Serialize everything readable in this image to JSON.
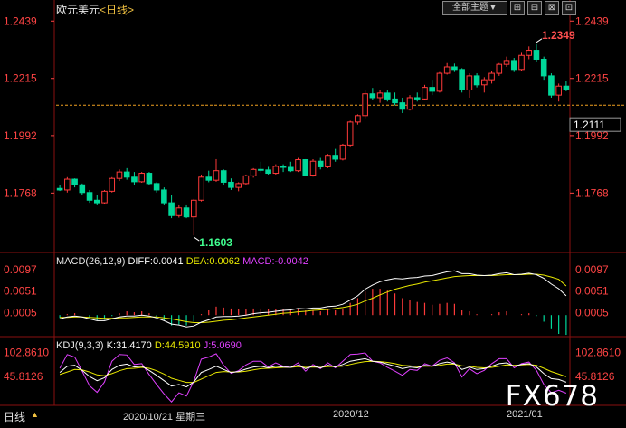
{
  "header": {
    "symbol": "欧元美元",
    "timeframe": "<日线>",
    "toolbar": {
      "theme_label": "全部主题",
      "theme_arrow": "▼",
      "buttons": [
        "⊞",
        "⊟",
        "⊠",
        "⊡"
      ]
    }
  },
  "colors": {
    "up": "#ff3a3a",
    "down": "#00d89a",
    "ma": "#ffffff",
    "dea": "#e8e800",
    "k": "#ffffff",
    "d": "#e8e800",
    "j": "#e040ff",
    "axis": "#ff4444",
    "grid": "#8a1010"
  },
  "chart_data": [
    {
      "type": "candlestick",
      "title": "欧元美元<日线>",
      "y_ticks": [
        "1.2439",
        "1.2215",
        "1.1992",
        "1.1768"
      ],
      "ylim": [
        1.1568,
        1.25
      ],
      "last_price": "1.2111",
      "high_annotation": "1.2349",
      "low_annotation": "1.1603",
      "ohlc": [
        [
          1.1786,
          1.1798,
          1.1776,
          1.178
        ],
        [
          1.178,
          1.183,
          1.177,
          1.1822
        ],
        [
          1.1822,
          1.1825,
          1.179,
          1.18
        ],
        [
          1.18,
          1.1805,
          1.176,
          1.177
        ],
        [
          1.177,
          1.178,
          1.173,
          1.174
        ],
        [
          1.174,
          1.176,
          1.172,
          1.173
        ],
        [
          1.173,
          1.178,
          1.1725,
          1.1775
        ],
        [
          1.1775,
          1.183,
          1.177,
          1.1825
        ],
        [
          1.1825,
          1.186,
          1.1815,
          1.185
        ],
        [
          1.185,
          1.1865,
          1.182,
          1.183
        ],
        [
          1.183,
          1.185,
          1.18,
          1.1812
        ],
        [
          1.1812,
          1.185,
          1.1808,
          1.1845
        ],
        [
          1.1845,
          1.185,
          1.18,
          1.1805
        ],
        [
          1.1805,
          1.181,
          1.177,
          1.178
        ],
        [
          1.178,
          1.179,
          1.172,
          1.173
        ],
        [
          1.173,
          1.176,
          1.167,
          1.168
        ],
        [
          1.168,
          1.172,
          1.1672,
          1.171
        ],
        [
          1.171,
          1.172,
          1.167,
          1.1675
        ],
        [
          1.1675,
          1.1745,
          1.1603,
          1.174
        ],
        [
          1.174,
          1.184,
          1.1735,
          1.183
        ],
        [
          1.183,
          1.1855,
          1.181,
          1.1818
        ],
        [
          1.1818,
          1.19,
          1.1812,
          1.1855
        ],
        [
          1.1855,
          1.186,
          1.18,
          1.181
        ],
        [
          1.181,
          1.1825,
          1.178,
          1.179
        ],
        [
          1.179,
          1.181,
          1.1775,
          1.1805
        ],
        [
          1.1805,
          1.184,
          1.18,
          1.1835
        ],
        [
          1.1835,
          1.1865,
          1.1828,
          1.186
        ],
        [
          1.186,
          1.189,
          1.1848,
          1.1858
        ],
        [
          1.1858,
          1.187,
          1.184,
          1.1845
        ],
        [
          1.1845,
          1.188,
          1.184,
          1.1872
        ],
        [
          1.1872,
          1.188,
          1.185,
          1.1868
        ],
        [
          1.1868,
          1.189,
          1.185,
          1.1855
        ],
        [
          1.1855,
          1.1905,
          1.185,
          1.1898
        ],
        [
          1.1898,
          1.19,
          1.1835,
          1.1838
        ],
        [
          1.1838,
          1.19,
          1.1832,
          1.1892
        ],
        [
          1.1892,
          1.1905,
          1.186,
          1.187
        ],
        [
          1.187,
          1.192,
          1.1865,
          1.1915
        ],
        [
          1.1915,
          1.194,
          1.189,
          1.19
        ],
        [
          1.19,
          1.196,
          1.1895,
          1.1955
        ],
        [
          1.1955,
          1.205,
          1.195,
          1.2045
        ],
        [
          1.2045,
          1.2075,
          1.2035,
          1.207
        ],
        [
          1.207,
          1.217,
          1.206,
          1.2155
        ],
        [
          1.2155,
          1.2178,
          1.213,
          1.214
        ],
        [
          1.214,
          1.217,
          1.212,
          1.2158
        ],
        [
          1.2158,
          1.2168,
          1.2125,
          1.2135
        ],
        [
          1.2135,
          1.216,
          1.211,
          1.212
        ],
        [
          1.212,
          1.214,
          1.208,
          1.2095
        ],
        [
          1.2095,
          1.215,
          1.209,
          1.214
        ],
        [
          1.214,
          1.216,
          1.2125,
          1.2135
        ],
        [
          1.2135,
          1.219,
          1.213,
          1.218
        ],
        [
          1.218,
          1.221,
          1.215,
          1.2165
        ],
        [
          1.2165,
          1.224,
          1.216,
          1.2235
        ],
        [
          1.2235,
          1.2275,
          1.223,
          1.226
        ],
        [
          1.226,
          1.2273,
          1.224,
          1.225
        ],
        [
          1.225,
          1.2255,
          1.216,
          1.217
        ],
        [
          1.217,
          1.2235,
          1.214,
          1.2225
        ],
        [
          1.2225,
          1.2235,
          1.218,
          1.219
        ],
        [
          1.219,
          1.222,
          1.216,
          1.221
        ],
        [
          1.221,
          1.2245,
          1.2195,
          1.2235
        ],
        [
          1.2235,
          1.2275,
          1.2225,
          1.227
        ],
        [
          1.227,
          1.23,
          1.226,
          1.2285
        ],
        [
          1.2285,
          1.2295,
          1.224,
          1.225
        ],
        [
          1.225,
          1.2315,
          1.2245,
          1.2305
        ],
        [
          1.2305,
          1.234,
          1.229,
          1.2325
        ],
        [
          1.2325,
          1.2349,
          1.228,
          1.229
        ],
        [
          1.229,
          1.23,
          1.221,
          1.2225
        ],
        [
          1.2225,
          1.2235,
          1.214,
          1.215
        ],
        [
          1.215,
          1.2195,
          1.2125,
          1.2185
        ],
        [
          1.2185,
          1.2205,
          1.2165,
          1.217
        ]
      ]
    },
    {
      "type": "line",
      "title": "MACD(26,12,9)",
      "labels": {
        "name": "MACD(26,12,9)",
        "diff": "DIFF:0.0041",
        "dea": "DEA:0.0062",
        "macd": "MACD:-0.0042"
      },
      "y_ticks": [
        "0.0097",
        "0.0051",
        "0.0005"
      ],
      "ylim": [
        -0.004,
        0.011
      ],
      "diff": [
        -0.0008,
        -0.0004,
        -0.0002,
        -0.0004,
        -0.0008,
        -0.0012,
        -0.0012,
        -0.0008,
        -0.0004,
        -0.0002,
        -0.0002,
        0.0,
        -0.0002,
        -0.0006,
        -0.0012,
        -0.0019,
        -0.0021,
        -0.0025,
        -0.0023,
        -0.0015,
        -0.001,
        -0.0004,
        -0.0003,
        -0.0003,
        -0.0002,
        0.0,
        0.0003,
        0.0005,
        0.0006,
        0.0008,
        0.001,
        0.0011,
        0.0014,
        0.0013,
        0.0015,
        0.0015,
        0.0018,
        0.0019,
        0.0023,
        0.0032,
        0.0041,
        0.0055,
        0.0064,
        0.0071,
        0.0075,
        0.0078,
        0.0077,
        0.0079,
        0.008,
        0.0083,
        0.0084,
        0.0088,
        0.0092,
        0.0094,
        0.0088,
        0.0088,
        0.0085,
        0.0084,
        0.0085,
        0.0088,
        0.009,
        0.0086,
        0.0087,
        0.0089,
        0.0086,
        0.0078,
        0.0066,
        0.0056,
        0.0041
      ],
      "dea": [
        -0.0005,
        -0.0005,
        -0.0004,
        -0.0004,
        -0.0005,
        -0.0006,
        -0.0007,
        -0.0007,
        -0.0006,
        -0.0006,
        -0.0005,
        -0.0004,
        -0.0004,
        -0.0004,
        -0.0006,
        -0.0008,
        -0.0011,
        -0.0014,
        -0.0016,
        -0.0016,
        -0.0015,
        -0.0013,
        -0.0011,
        -0.001,
        -0.0008,
        -0.0006,
        -0.0004,
        -0.0002,
        0.0,
        0.0002,
        0.0004,
        0.0005,
        0.0007,
        0.0008,
        0.001,
        0.0011,
        0.0012,
        0.0014,
        0.0016,
        0.0019,
        0.0023,
        0.003,
        0.0036,
        0.0043,
        0.0049,
        0.0055,
        0.0059,
        0.0063,
        0.0066,
        0.007,
        0.0073,
        0.0076,
        0.0079,
        0.0082,
        0.0083,
        0.0084,
        0.0084,
        0.0084,
        0.0084,
        0.0085,
        0.0086,
        0.0086,
        0.0086,
        0.0087,
        0.0087,
        0.0085,
        0.0081,
        0.0076,
        0.0062
      ],
      "histogram": [
        -0.0006,
        0.0002,
        0.0004,
        0.0,
        -0.0006,
        -0.0012,
        -0.001,
        -0.0002,
        0.0004,
        0.0008,
        0.0006,
        0.0008,
        0.0004,
        -0.0004,
        -0.0012,
        -0.0022,
        -0.002,
        -0.0022,
        -0.0014,
        0.0002,
        0.001,
        0.0018,
        0.0016,
        0.0014,
        0.0012,
        0.0012,
        0.0014,
        0.0014,
        0.0012,
        0.0012,
        0.0012,
        0.0012,
        0.0014,
        0.001,
        0.001,
        0.0008,
        0.0012,
        0.001,
        0.0014,
        0.0026,
        0.0036,
        0.005,
        0.0056,
        0.0056,
        0.0052,
        0.0046,
        0.0036,
        0.0032,
        0.0028,
        0.0026,
        0.0022,
        0.0024,
        0.0026,
        0.0024,
        0.001,
        0.0008,
        0.0002,
        0.0,
        0.0002,
        0.0006,
        0.0008,
        0.0,
        0.0002,
        0.0004,
        -0.0002,
        -0.0014,
        -0.003,
        -0.004,
        -0.0042
      ]
    },
    {
      "type": "line",
      "title": "KDJ(9,3,3)",
      "labels": {
        "name": "KDJ(9,3,3)",
        "k": "K:31.4170",
        "d": "D:44.5910",
        "j": "J:5.0690"
      },
      "y_ticks": [
        "102.8610",
        "45.8126"
      ],
      "ylim": [
        -20,
        115
      ],
      "k": [
        55,
        70,
        72,
        60,
        45,
        35,
        42,
        62,
        72,
        75,
        68,
        70,
        60,
        48,
        35,
        22,
        26,
        20,
        32,
        55,
        62,
        70,
        62,
        55,
        57,
        63,
        68,
        70,
        66,
        70,
        68,
        67,
        72,
        64,
        70,
        66,
        72,
        68,
        74,
        82,
        85,
        88,
        82,
        80,
        75,
        70,
        64,
        68,
        66,
        72,
        70,
        76,
        80,
        76,
        62,
        68,
        62,
        64,
        70,
        76,
        78,
        70,
        74,
        76,
        68,
        52,
        40,
        38,
        31.417
      ],
      "d": [
        50,
        56,
        62,
        61,
        56,
        49,
        47,
        52,
        59,
        64,
        65,
        67,
        65,
        59,
        51,
        41,
        36,
        31,
        31,
        39,
        47,
        55,
        57,
        56,
        56,
        58,
        61,
        64,
        65,
        66,
        67,
        67,
        69,
        67,
        68,
        67,
        69,
        69,
        70,
        74,
        78,
        81,
        82,
        81,
        79,
        76,
        72,
        71,
        69,
        70,
        70,
        72,
        75,
        75,
        71,
        70,
        67,
        66,
        67,
        70,
        73,
        72,
        73,
        74,
        72,
        65,
        57,
        51,
        44.591
      ],
      "j": [
        65,
        98,
        92,
        58,
        23,
        7,
        32,
        82,
        98,
        97,
        74,
        76,
        50,
        26,
        3,
        -16,
        6,
        -2,
        34,
        87,
        92,
        100,
        72,
        53,
        59,
        73,
        82,
        82,
        68,
        78,
        70,
        67,
        78,
        58,
        74,
        64,
        78,
        66,
        82,
        98,
        99,
        102,
        82,
        78,
        67,
        58,
        48,
        62,
        60,
        76,
        70,
        84,
        90,
        78,
        44,
        64,
        52,
        60,
        76,
        88,
        88,
        66,
        76,
        80,
        60,
        26,
        6,
        12,
        5.069
      ]
    }
  ],
  "x_axis_labels": [
    "2020/10/21 星期三",
    "2020/12",
    "2021/01"
  ],
  "bottom": {
    "period_tab": "日线",
    "scroll_arrow": "▲"
  },
  "watermark": "FX678"
}
